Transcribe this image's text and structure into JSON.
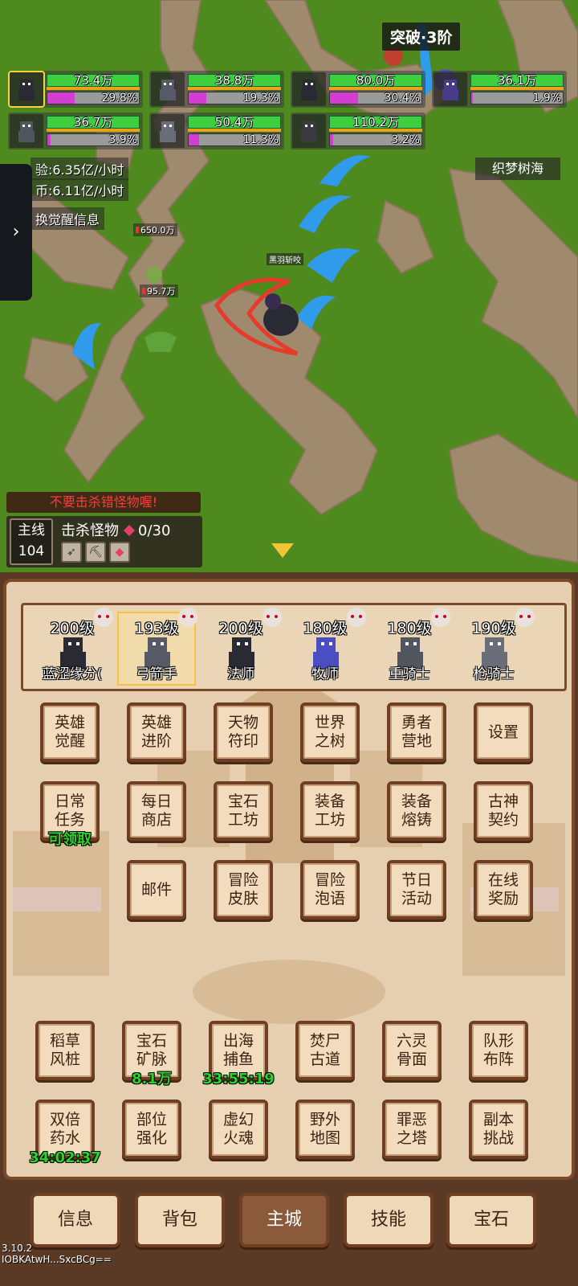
{
  "party": [
    {
      "hp": "73.4万",
      "exp": "29.8%",
      "exp_frac": 0.298,
      "selected": true
    },
    {
      "hp": "38.8万",
      "exp": "19.3%",
      "exp_frac": 0.193
    },
    {
      "hp": "80.0万",
      "exp": "30.4%",
      "exp_frac": 0.304
    },
    {
      "hp": "36.1万",
      "exp": "1.9%",
      "exp_frac": 0.019
    },
    {
      "hp": "36.7万",
      "exp": "3.9%",
      "exp_frac": 0.039
    },
    {
      "hp": "50.4万",
      "exp": "11.3%",
      "exp_frac": 0.113
    },
    {
      "hp": "110.2万",
      "exp": "3.2%",
      "exp_frac": 0.032
    }
  ],
  "stage_badge": "突破·3阶",
  "rates": {
    "exp": "验:6.35亿/小时",
    "gold": "币:6.11亿/小时",
    "awaken": "换觉醒信息"
  },
  "zone": "织梦树海",
  "side_tab": "›",
  "damage_tags": [
    "650.0万",
    "95.7万"
  ],
  "skill_name": "黑羽斩咬",
  "warning": "不要击杀错怪物喔!",
  "quest": {
    "main_label": "主线",
    "main_num": "104",
    "title": "击杀怪物",
    "progress": "0/30"
  },
  "heroes": [
    {
      "level": "200级",
      "name": "蓝涩缘分("
    },
    {
      "level": "193级",
      "name": "弓箭手",
      "selected": true
    },
    {
      "level": "200级",
      "name": "法师"
    },
    {
      "level": "180级",
      "name": "牧师"
    },
    {
      "level": "180级",
      "name": "重骑士"
    },
    {
      "level": "190级",
      "name": "枪骑士"
    }
  ],
  "menu": {
    "r1": [
      "英雄\n觉醒",
      "英雄\n进阶",
      "天物\n符印",
      "世界\n之树",
      "勇者\n营地",
      "设置"
    ],
    "r2": [
      "日常\n任务",
      "每日\n商店",
      "宝石\n工坊",
      "装备\n工坊",
      "装备\n熔铸",
      "古神\n契约"
    ],
    "r2_sub": "可领取",
    "r3": [
      "邮件",
      "冒险\n皮肤",
      "冒险\n泡语",
      "节日\n活动",
      "在线\n奖励"
    ],
    "r4": [
      "稻草\n风桩",
      "宝石\n矿脉",
      "出海\n捕鱼",
      "焚尸\n古道",
      "六灵\n骨面",
      "队形\n布阵"
    ],
    "r4_sub": [
      "",
      "8.1万",
      "33:55:19",
      "",
      "",
      ""
    ],
    "r5": [
      "双倍\n药水",
      "部位\n强化",
      "虚幻\n火魂",
      "野外\n地图",
      "罪恶\n之塔",
      "副本\n挑战"
    ],
    "r5_sub": [
      "34:02:37",
      "",
      "",
      "",
      "",
      ""
    ]
  },
  "nav": [
    "信息",
    "背包",
    "主城",
    "技能",
    "宝石"
  ],
  "nav_active": 2,
  "version": "3.10.2",
  "device_id": "IOBKAtwH...SxcBCg=="
}
